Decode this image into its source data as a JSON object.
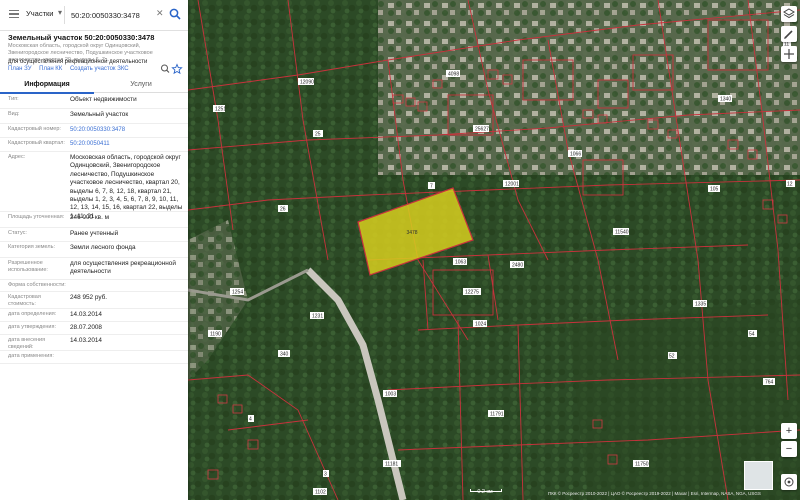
{
  "search": {
    "layer_label": "Участки",
    "query": "50:20:0050330:3478"
  },
  "header": {
    "title": "Земельный участок 50:20:0050330:3478",
    "address_short": "Московская область, городской округ Одинцовский, Звенигородское лесничество, Подушкинское участковое лесничество, квартал 20, выделы 6, 7,..",
    "link_plan_zu": "План ЗУ",
    "link_plan_ks": "План КК",
    "link_create": "Создать участок ЗКС",
    "usage": "для осуществления рекреационной деятельности"
  },
  "tabs": [
    {
      "label": "Информация",
      "active": true
    },
    {
      "label": "Услуги",
      "active": false
    }
  ],
  "info_rows": [
    {
      "label": "Тип:",
      "value": "Объект недвижимости"
    },
    {
      "label": "Вид:",
      "value": "Земельный участок"
    },
    {
      "label": "Кадастровый номер:",
      "value": "50:20:0050330:3478",
      "link": true
    },
    {
      "label": "Кадастровый квартал:",
      "value": "50:20:0050411",
      "link": true
    },
    {
      "label": "Адрес:",
      "value": "Московская область, городской округ Одинцовский, Звенигородское лесничество, Подушкинское участковое лесничество, квартал 20, выделы 6, 7, 8, 12, 18, квартал 21, выделы 1, 2, 3, 4, 5, 6, 7, 8, 9, 10, 11, 12, 13, 14, 15, 16, квартал 22, выделы 1, 11, 21"
    },
    {
      "label": "Площадь уточненная:",
      "value": "246 000 кв. м"
    },
    {
      "label": "Статус:",
      "value": "Ранее учтенный"
    },
    {
      "label": "Категория земель:",
      "value": "Земли лесного фонда"
    },
    {
      "label": "Разрешенное использование:",
      "value": "для осуществления рекреационной деятельности"
    },
    {
      "label": "Форма собственности:",
      "value": ""
    },
    {
      "label": "Кадастровая стоимость:",
      "value": "248 952 руб."
    },
    {
      "label": "дата определения:",
      "value": "14.03.2014"
    },
    {
      "label": "дата утверждения:",
      "value": "28.07.2008"
    },
    {
      "label": "дата внесения сведений:",
      "value": "14.03.2014"
    },
    {
      "label": "дата применения:",
      "value": ""
    }
  ],
  "map": {
    "selected_parcel_label": "3478",
    "parcel_labels": [
      "12090",
      "4098",
      "1251",
      "25627",
      "12001",
      "1063",
      "25",
      "2480",
      "11540",
      "26",
      "1340",
      "7",
      "1066",
      "11",
      "12",
      "1335",
      "1024",
      "12275",
      "1190",
      "1254",
      "1231",
      "340",
      "1003",
      "11181",
      "105",
      "52",
      "54",
      "4",
      "3",
      "764",
      "11791",
      "11750",
      "1102"
    ],
    "scale_label": "0.2 км",
    "attribution": "ПКК © Росреестр 2010-2022 | ЦАО © Росреестр 2019-2022 | Maxar | Esri, Intermap, NASA, NGA, USGS",
    "colors": {
      "parcel_border": "#c8323c",
      "selected_fill": "#d7ce1e",
      "forest": "#2c4a26"
    }
  },
  "controls": {
    "layers_icon": "layers-icon",
    "edit_icon": "pencil-icon",
    "zoom_in": "+",
    "zoom_out": "−"
  }
}
